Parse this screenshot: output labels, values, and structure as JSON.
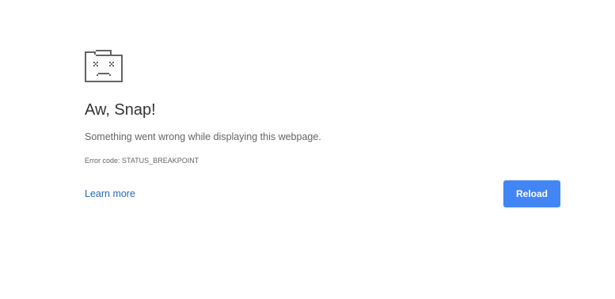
{
  "error_page": {
    "icon": "sad-tab-icon",
    "title": "Aw, Snap!",
    "message": "Something went wrong while displaying this webpage.",
    "error_code": "Error code: STATUS_BREAKPOINT",
    "learn_more_label": "Learn more",
    "reload_label": "Reload"
  },
  "colors": {
    "accent": "#4285f4",
    "link": "#2a6ab8",
    "icon": "#646464"
  }
}
